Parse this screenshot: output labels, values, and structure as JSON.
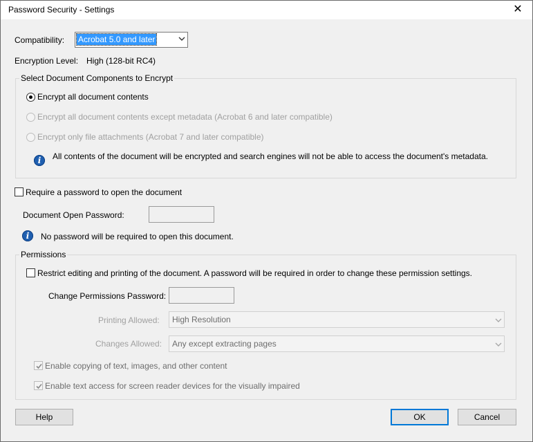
{
  "window": {
    "title": "Password Security - Settings",
    "close_glyph": "✕"
  },
  "compatibility": {
    "label": "Compatibility:",
    "value": "Acrobat 5.0 and later"
  },
  "encryption": {
    "label": "Encryption  Level:",
    "value": "High (128-bit RC4)"
  },
  "components": {
    "legend": "Select Document Components to Encrypt",
    "options": [
      {
        "label": "Encrypt all document contents",
        "checked": true,
        "enabled": true
      },
      {
        "label": "Encrypt all document contents except metadata (Acrobat 6 and later compatible)",
        "checked": false,
        "enabled": false
      },
      {
        "label": "Encrypt only file attachments (Acrobat 7 and later compatible)",
        "checked": false,
        "enabled": false
      }
    ],
    "info_text": "All contents of the document will be encrypted and search engines will not be able to access the document's metadata."
  },
  "open_password": {
    "checkbox_label": "Require a password to open the document",
    "checked": false,
    "field_label": "Document Open Password:",
    "field_value": "",
    "info_text": "No password will be required to open this document."
  },
  "permissions": {
    "legend": "Permissions",
    "restrict_label": "Restrict editing and printing of the document. A password will be required in order to change these permission settings.",
    "restrict_checked": false,
    "change_password_label": "Change Permissions Password:",
    "change_password_value": "",
    "printing_label": "Printing Allowed:",
    "printing_value": "High Resolution",
    "changes_label": "Changes Allowed:",
    "changes_value": "Any except extracting pages",
    "copy_label": "Enable copying of text, images, and other content",
    "copy_checked": true,
    "screen_reader_label": "Enable text access for screen reader devices for the visually impaired",
    "screen_reader_checked": true
  },
  "buttons": {
    "help": "Help",
    "ok": "OK",
    "cancel": "Cancel"
  },
  "icons": {
    "info": "info-icon",
    "dropdown": "chevron-down-icon",
    "check": "checkmark-icon"
  },
  "colors": {
    "selection": "#3399ff",
    "default_button": "#0078d7",
    "info_blue": "#1f5fb0"
  }
}
